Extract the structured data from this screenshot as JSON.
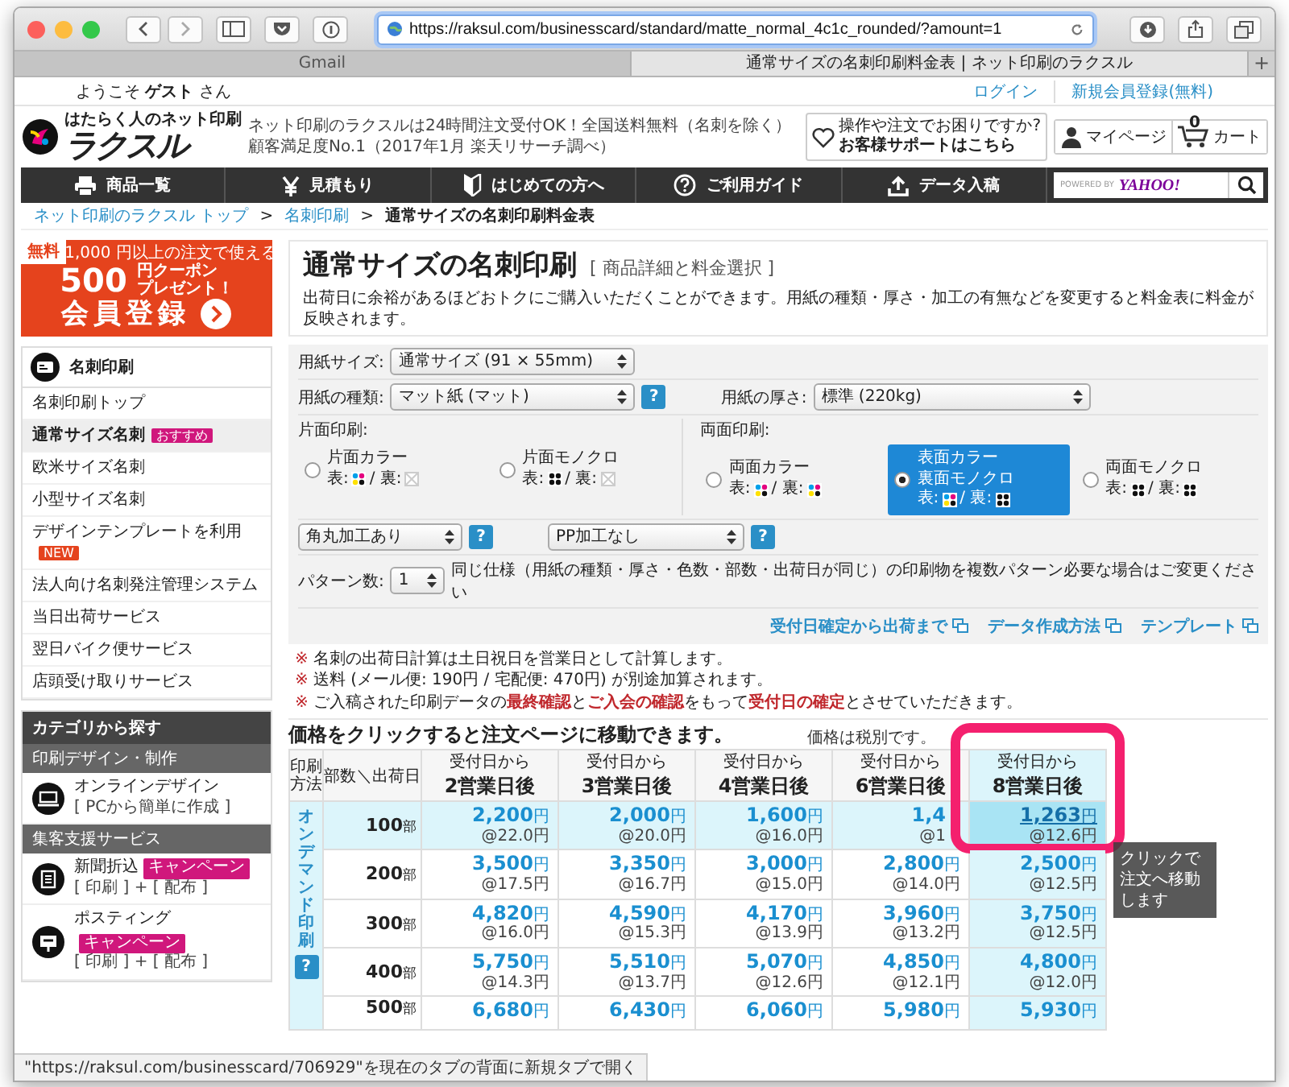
{
  "browser": {
    "url": "https://raksul.com/businesscard/standard/matte_normal_4c1c_rounded/?amount=1",
    "tabs": [
      {
        "label": "Gmail",
        "selected": false
      },
      {
        "label": "通常サイズの名刺印刷料金表 | ネット印刷のラクスル",
        "selected": true
      }
    ],
    "new_tab": "+",
    "status": "\"https://raksul.com/businesscard/706929\"を現在のタブの背面に新規タブで開く"
  },
  "topbar": {
    "welcome": "ようこそ **ゲスト** さん",
    "links": [
      "ログイン",
      "新規会員登録(無料)"
    ]
  },
  "header": {
    "logo_caption": "はたらく人のネット印刷",
    "logo": "ラクスル",
    "tagline": [
      "ネット印刷のラクスルは24時間注文受付OK！全国送料無料（名刺を除く）",
      "顧客満足度No.1（2017年1月 楽天リサーチ調べ）"
    ],
    "support": {
      "line1": "操作や注文でお困りですか?",
      "line2": "お客様サポートはこちら"
    },
    "mypage": "マイページ",
    "cart": {
      "label": "カート",
      "count": "0"
    }
  },
  "nav": {
    "items": [
      {
        "label": "商品一覧",
        "kind": "printer"
      },
      {
        "label": "見積もり",
        "kind": "yen"
      },
      {
        "label": "はじめての方へ",
        "kind": "leaf"
      },
      {
        "label": "ご利用ガイド",
        "kind": "question"
      },
      {
        "label": "データ入稿",
        "kind": "upload"
      }
    ],
    "search": {
      "powered_by": "POWERED BY",
      "brand": "YAHOO!"
    }
  },
  "breadcrumb": {
    "separator": ">",
    "items": [
      {
        "label": "ネット印刷のラクスル トップ",
        "link": true
      },
      {
        "label": "名刺印刷",
        "link": true
      },
      {
        "label": "通常サイズの名刺印刷料金表",
        "link": false
      }
    ]
  },
  "banner": {
    "tag": "無料",
    "condition": "1,000 円以上の注文で使える",
    "amount": "500",
    "offer": [
      "円クーポン",
      "プレゼント！"
    ],
    "cta": "会員登録"
  },
  "sidebar": {
    "title": "名刺印刷",
    "items": [
      {
        "label": "名刺印刷トップ",
        "selected": false
      },
      {
        "label": "通常サイズ名刺",
        "selected": true,
        "badge": {
          "label": "おすすめ",
          "color": "#d0177c"
        }
      },
      {
        "label": "欧米サイズ名刺",
        "selected": false
      },
      {
        "label": "小型サイズ名刺",
        "selected": false
      },
      {
        "label": "デザインテンプレートを利用",
        "selected": false,
        "badge": {
          "label": "NEW",
          "color": "#e5431d"
        }
      },
      {
        "label": "法人向け名刺発注管理システム",
        "selected": false
      },
      {
        "label": "当日出荷サービス",
        "selected": false
      },
      {
        "label": "翌日バイク便サービス",
        "selected": false
      },
      {
        "label": "店頭受け取りサービス",
        "selected": false
      }
    ],
    "categories": {
      "title": "カテゴリから探す",
      "sections": [
        {
          "title": "印刷デザイン・制作",
          "items": [
            {
              "label": "オンラインデザイン",
              "sub": "[ PCから簡単に作成 ]",
              "kind": "laptop"
            }
          ]
        },
        {
          "title": "集客支援サービス",
          "items": [
            {
              "label": "新聞折込",
              "badge": "キャンペーン",
              "sub": "[ 印刷 ] + [ 配布 ]",
              "kind": "newspaper"
            },
            {
              "label": "ポスティング",
              "badge": "キャンペーン",
              "sub": "[ 印刷 ] + [ 配布 ]",
              "kind": "mailbox"
            }
          ]
        }
      ]
    }
  },
  "product": {
    "title": "通常サイズの名刺印刷",
    "subtitle": "[ 商品詳細と料金選択 ]",
    "intro": "出荷日に余裕があるほどおトクにご購入いただくことができます。用紙の種類・厚さ・加工の有無などを変更すると料金表に料金が反映されます。"
  },
  "form": {
    "size": {
      "label": "用紙サイズ:",
      "value": "通常サイズ (91 × 55mm)"
    },
    "paper": {
      "label": "用紙の種類:",
      "value": "マット紙 (マット)",
      "help": "?"
    },
    "thickness": {
      "label": "用紙の厚さ:",
      "value": "標準 (220kg)"
    },
    "print_groups": [
      {
        "title": "片面印刷:",
        "options": [
          {
            "label": [
              "片面カラー"
            ],
            "front": {
              "label": "表:",
              "kind": "color"
            },
            "back": {
              "label": "/ 裏:",
              "kind": "none"
            },
            "selected": false
          },
          {
            "label": [
              "片面モノクロ"
            ],
            "front": {
              "label": "表:",
              "kind": "mono"
            },
            "back": {
              "label": "/ 裏:",
              "kind": "none"
            },
            "selected": false
          }
        ]
      },
      {
        "title": "両面印刷:",
        "options": [
          {
            "label": [
              "両面カラー"
            ],
            "front": {
              "label": "表:",
              "kind": "color"
            },
            "back": {
              "label": "/ 裏:",
              "kind": "color"
            },
            "selected": false
          },
          {
            "label": [
              "表面カラー",
              "裏面モノクロ"
            ],
            "front": {
              "label": "表:",
              "kind": "color"
            },
            "back": {
              "label": "/ 裏:",
              "kind": "mono"
            },
            "selected": true
          },
          {
            "label": [
              "両面モノクロ"
            ],
            "front": {
              "label": "表:",
              "kind": "mono"
            },
            "back": {
              "label": "/ 裏:",
              "kind": "mono"
            },
            "selected": false
          }
        ]
      }
    ],
    "corner": {
      "value": "角丸加工あり",
      "help": "?"
    },
    "coating": {
      "value": "PP加工なし",
      "help": "?"
    },
    "pattern": {
      "label": "パターン数:",
      "value": "1",
      "note": "同じ仕様（用紙の種類・厚さ・色数・部数・出荷日が同じ）の印刷物を複数パターン必要な場合はご変更ください"
    },
    "links": [
      "受付日確定から出荷まで",
      "データ作成方法",
      "テンプレート"
    ]
  },
  "notes": [
    {
      "mark": "※",
      "text": "名刺の出荷日計算は土日祝日を営業日として計算します。"
    },
    {
      "mark": "※",
      "text": "送料 (メール便: 190円 / 宅配便: 470円) が別途加算されます。"
    },
    {
      "mark": "※",
      "text": "ご入稿された印刷データの**最終確認**と**ご入会の確認**をもって**受付日の確定**とさせていただきます。"
    }
  ],
  "prices": {
    "title": "価格をクリックすると注文ページに移動できます。",
    "tax_note": "価格は税別です。",
    "method_header": "印刷方法",
    "qty_header": "部数＼出荷日",
    "columns": [
      {
        "top": "受付日から",
        "main": "2営業日後",
        "selected": false
      },
      {
        "top": "受付日から",
        "main": "3営業日後",
        "selected": false
      },
      {
        "top": "受付日から",
        "main": "4営業日後",
        "selected": false
      },
      {
        "top": "受付日から",
        "main": "6営業日後",
        "selected": false
      },
      {
        "top": "受付日から",
        "main": "8営業日後",
        "selected": true
      }
    ],
    "method": "オンデマンド印刷",
    "method_help": "?",
    "rows": [
      {
        "qty": "100",
        "unit": "部",
        "selected": true,
        "cells": [
          {
            "price": "2,200",
            "unit": "円",
            "each": "@22.0円"
          },
          {
            "price": "2,000",
            "unit": "円",
            "each": "@20.0円"
          },
          {
            "price": "1,600",
            "unit": "円",
            "each": "@16.0円"
          },
          {
            "price": "1,4",
            "each": "@1",
            "clipped": true
          },
          {
            "price": "1,263",
            "unit": "円",
            "each": "@12.6円"
          }
        ]
      },
      {
        "qty": "200",
        "unit": "部",
        "selected": false,
        "cells": [
          {
            "price": "3,500",
            "unit": "円",
            "each": "@17.5円"
          },
          {
            "price": "3,350",
            "unit": "円",
            "each": "@16.7円"
          },
          {
            "price": "3,000",
            "unit": "円",
            "each": "@15.0円"
          },
          {
            "price": "2,800",
            "unit": "円",
            "each": "@14.0円"
          },
          {
            "price": "2,500",
            "unit": "円",
            "each": "@12.5円"
          }
        ]
      },
      {
        "qty": "300",
        "unit": "部",
        "selected": false,
        "cells": [
          {
            "price": "4,820",
            "unit": "円",
            "each": "@16.0円"
          },
          {
            "price": "4,590",
            "unit": "円",
            "each": "@15.3円"
          },
          {
            "price": "4,170",
            "unit": "円",
            "each": "@13.9円"
          },
          {
            "price": "3,960",
            "unit": "円",
            "each": "@13.2円"
          },
          {
            "price": "3,750",
            "unit": "円",
            "each": "@12.5円"
          }
        ]
      },
      {
        "qty": "400",
        "unit": "部",
        "selected": false,
        "cells": [
          {
            "price": "5,750",
            "unit": "円",
            "each": "@14.3円"
          },
          {
            "price": "5,510",
            "unit": "円",
            "each": "@13.7円"
          },
          {
            "price": "5,070",
            "unit": "円",
            "each": "@12.6円"
          },
          {
            "price": "4,850",
            "unit": "円",
            "each": "@12.1円"
          },
          {
            "price": "4,800",
            "unit": "円",
            "each": "@12.0円"
          }
        ]
      },
      {
        "qty": "500",
        "unit": "部",
        "selected": false,
        "cells": [
          {
            "price": "6,680",
            "unit": "円"
          },
          {
            "price": "6,430",
            "unit": "円"
          },
          {
            "price": "6,060",
            "unit": "円"
          },
          {
            "price": "5,980",
            "unit": "円"
          },
          {
            "price": "5,930",
            "unit": "円"
          }
        ]
      }
    ],
    "tooltip": "クリックで注文へ移動します"
  }
}
